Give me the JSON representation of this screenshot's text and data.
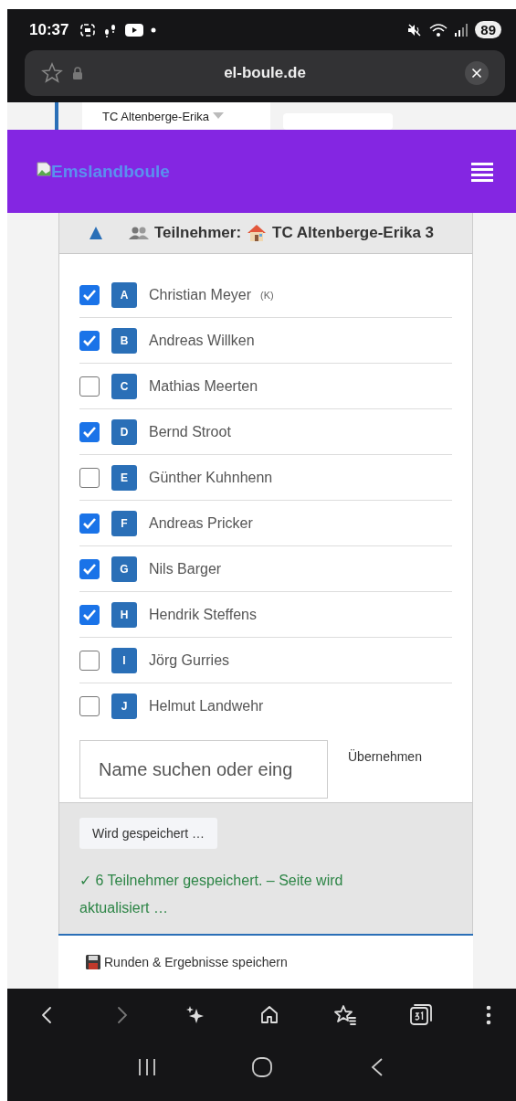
{
  "status_bar": {
    "time": "10:37",
    "battery": "89"
  },
  "browser": {
    "url": "el-boule.de"
  },
  "team_select": {
    "value": "TC Altenberge-Erika"
  },
  "header": {
    "brand": "Emslandboule"
  },
  "card": {
    "expanded": true,
    "title": "Teilnehmer:",
    "team": "TC Altenberge-Erika 3"
  },
  "players": [
    {
      "letter": "A",
      "name": "Christian Meyer",
      "note": "(K)",
      "checked": true
    },
    {
      "letter": "B",
      "name": "Andreas Willken",
      "checked": true
    },
    {
      "letter": "C",
      "name": "Mathias Meerten",
      "checked": false
    },
    {
      "letter": "D",
      "name": "Bernd Stroot",
      "checked": true
    },
    {
      "letter": "E",
      "name": "Günther Kuhnhenn",
      "checked": false
    },
    {
      "letter": "F",
      "name": "Andreas Pricker",
      "checked": true
    },
    {
      "letter": "G",
      "name": "Nils Barger",
      "checked": true
    },
    {
      "letter": "H",
      "name": "Hendrik Steffens",
      "checked": true
    },
    {
      "letter": "I",
      "name": "Jörg Gurries",
      "checked": false
    },
    {
      "letter": "J",
      "name": "Helmut Landwehr",
      "checked": false
    }
  ],
  "search": {
    "placeholder": "Name suchen oder eing",
    "button": "Übernehmen"
  },
  "footer": {
    "save_button": "Wird gespeichert …",
    "message": "✓ 6 Teilnehmer gespeichert. – Seite wird aktualisiert …"
  },
  "sticky_bar": {
    "label": "Runden & Ergebnisse speichern"
  }
}
